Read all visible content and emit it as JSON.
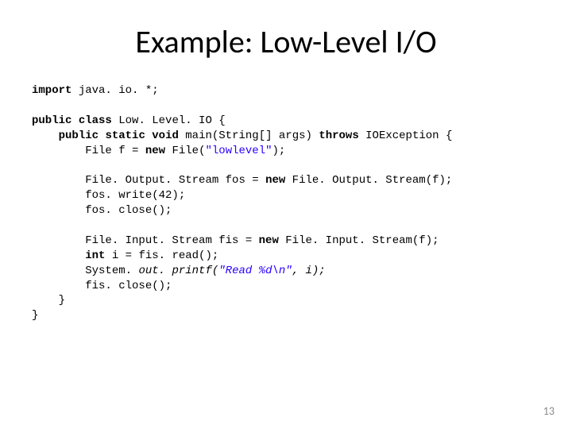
{
  "title": "Example: Low-Level I/O",
  "pagenum": "13",
  "code": {
    "l1_kw": "import",
    "l1_rest": " java. io. *;",
    "l2_kw1": "public",
    "l2_sp1": " ",
    "l2_kw2": "class",
    "l2_rest": " Low. Level. IO {",
    "l3_indent": "    ",
    "l3_kw1": "public",
    "l3_sp1": " ",
    "l3_kw2": "static",
    "l3_sp2": " ",
    "l3_kw3": "void",
    "l3_mid": " main(String[] args) ",
    "l3_kw4": "throws",
    "l3_rest": " IOException {",
    "l4_indent": "        ",
    "l4_a": "File f = ",
    "l4_kw": "new",
    "l4_b": " File(",
    "l4_str": "\"lowlevel\"",
    "l4_c": ");",
    "l5_indent": "        ",
    "l5_a": "File. Output. Stream fos = ",
    "l5_kw": "new",
    "l5_b": " File. Output. Stream(f);",
    "l6": "        fos. write(42);",
    "l7": "        fos. close();",
    "l8_indent": "        ",
    "l8_a": "File. Input. Stream fis = ",
    "l8_kw": "new",
    "l8_b": " File. Input. Stream(f);",
    "l9_indent": "        ",
    "l9_kw": "int",
    "l9_rest": " i = fis. read();",
    "l10_indent": "        ",
    "l10_a": "System. ",
    "l10_it1": "out. printf(",
    "l10_str": "\"Read %d\\n\"",
    "l10_it2": ", i);",
    "l11": "        fis. close();",
    "l12": "    }",
    "l13": "}"
  }
}
